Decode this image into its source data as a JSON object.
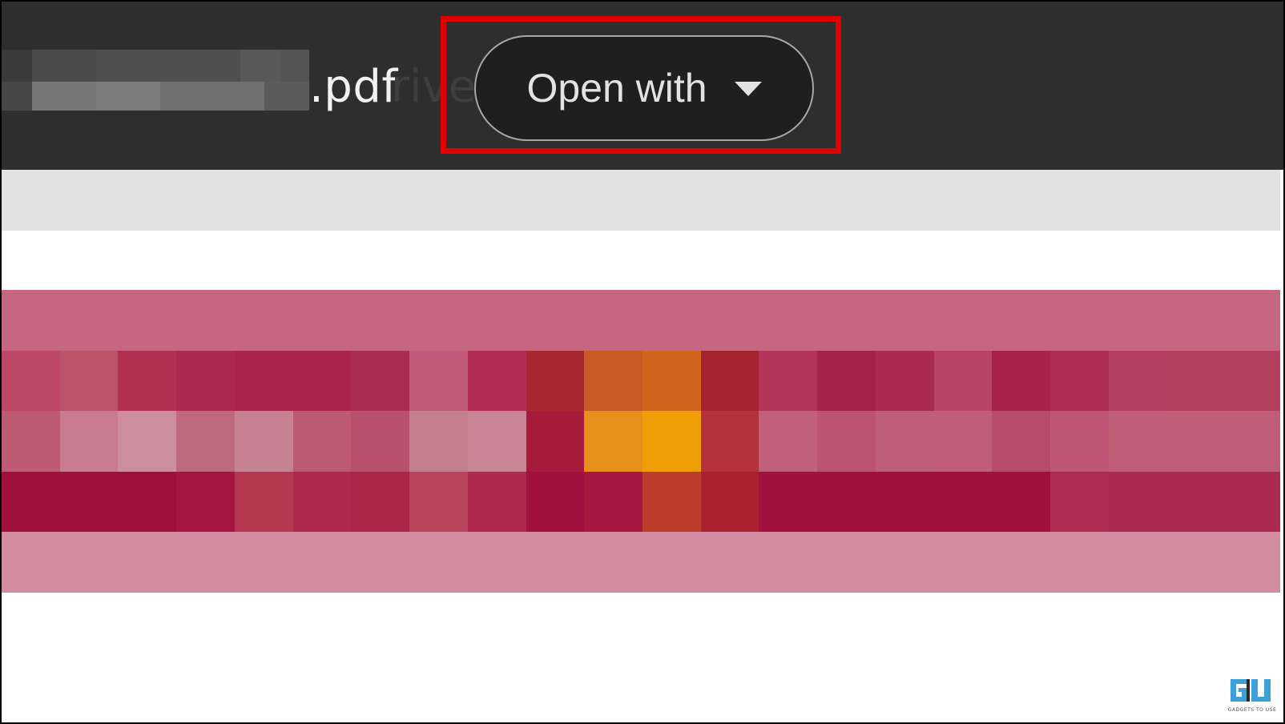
{
  "header": {
    "filename_extension": ".pdf",
    "background_label_fragment": "rive",
    "open_with_button": {
      "label": "Open with",
      "icon": "caret-down-icon"
    }
  },
  "annotation": {
    "highlight_color": "#e00000"
  },
  "watermark": {
    "logo_text": "GU",
    "caption": "GADGETS TO USE"
  },
  "colors": {
    "topbar": "#2e2e2e",
    "button_bg": "#1f1f1f",
    "highlight": "#e00000",
    "mosaic_pink": "#c4677f",
    "mosaic_crimson": "#a31040",
    "mosaic_orange": "#ef9e06"
  },
  "mosaic_rows": [
    [
      "#c4677f",
      "#c4677f",
      "#c4677f",
      "#c4677f",
      "#c4677f",
      "#c4677f",
      "#c4677f",
      "#c4677f",
      "#c4677f",
      "#c4677f",
      "#c4677f",
      "#c4677f",
      "#c4677f",
      "#c4677f",
      "#c4677f",
      "#c4677f",
      "#c4677f",
      "#c4677f",
      "#c4677f",
      "#c4677f",
      "#c4677f",
      "#c4677f"
    ],
    [
      "#bc4866",
      "#bc5469",
      "#b0304f",
      "#ad2a4f",
      "#aa2449",
      "#a9234b",
      "#ab2c51",
      "#c05a7a",
      "#b12d55",
      "#a82831",
      "#c95a24",
      "#d0641c",
      "#a52330",
      "#b23458",
      "#a5224a",
      "#ab2a52",
      "#b94366",
      "#a8234c",
      "#ae2c52",
      "#b6405f",
      "#b3405d",
      "#b3405d"
    ],
    [
      "#bc5a71",
      "#c97c90",
      "#cc8e9d",
      "#bf6a7c",
      "#c68291",
      "#bc5a71",
      "#b8526c",
      "#c47f8c",
      "#c88694",
      "#a81c3b",
      "#e6901a",
      "#ef9e06",
      "#b3323c",
      "#c0607b",
      "#bb5471",
      "#bf5e79",
      "#c05e7a",
      "#b64b6a",
      "#bd5775",
      "#c05e77",
      "#c05e77",
      "#c05e77"
    ],
    [
      "#a0103d",
      "#a0103d",
      "#a0103d",
      "#a5153f",
      "#b4384f",
      "#ad2a4d",
      "#aa2748",
      "#b9445c",
      "#ad2a4d",
      "#a1103e",
      "#a6163e",
      "#bc3c2c",
      "#a9202f",
      "#a1103e",
      "#a1103e",
      "#a1103e",
      "#a1103e",
      "#a1103e",
      "#ae2c50",
      "#ab2a4f",
      "#ab2a4f",
      "#ab2a4f"
    ],
    [
      "#d48ca2",
      "#d48ca2",
      "#d48ca2",
      "#d48ca2",
      "#d48ca2",
      "#d48ca2",
      "#d48ca2",
      "#d48ca2",
      "#d48ca2",
      "#d48ca2",
      "#d48ca2",
      "#d48ca2",
      "#d48ca2",
      "#d48ca2",
      "#d48ca2",
      "#d48ca2",
      "#d48ca2",
      "#d48ca2",
      "#d48ca2",
      "#d48ca2",
      "#d48ca2",
      "#d48ca2"
    ]
  ]
}
